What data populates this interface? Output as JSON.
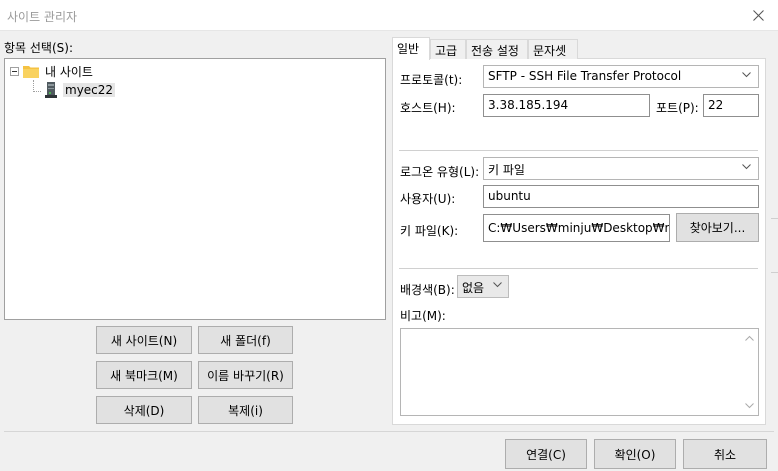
{
  "window": {
    "title": "사이트 관리자"
  },
  "tree": {
    "label": "항목 선택(S):",
    "root": "내 사이트",
    "site": "myec22"
  },
  "left_buttons": {
    "new_site": "새 사이트(N)",
    "new_folder": "새 폴더(f)",
    "new_bookmark": "새 북마크(M)",
    "rename": "이름 바꾸기(R)",
    "delete": "삭제(D)",
    "duplicate": "복제(i)"
  },
  "tabs": [
    "일반",
    "고급",
    "전송 설정",
    "문자셋"
  ],
  "general": {
    "protocol_label": "프로토콜(t):",
    "protocol_value": "SFTP - SSH File Transfer Protocol",
    "host_label": "호스트(H):",
    "host_value": "3.38.185.194",
    "port_label": "포트(P):",
    "port_value": "22",
    "logon_label": "로그온 유형(L):",
    "logon_value": "키 파일",
    "user_label": "사용자(U):",
    "user_value": "ubuntu",
    "keyfile_label": "키 파일(K):",
    "keyfile_value": "C:₩Users₩minju₩Desktop₩newl",
    "browse_label": "찾아보기...",
    "bgcolor_label": "배경색(B):",
    "bgcolor_value": "없음",
    "comment_label": "비고(M):"
  },
  "footer": {
    "connect": "연결(C)",
    "ok": "확인(O)",
    "cancel": "취소"
  },
  "colors": {
    "folder": "#f5c242",
    "selection": "#e5e5e5"
  }
}
